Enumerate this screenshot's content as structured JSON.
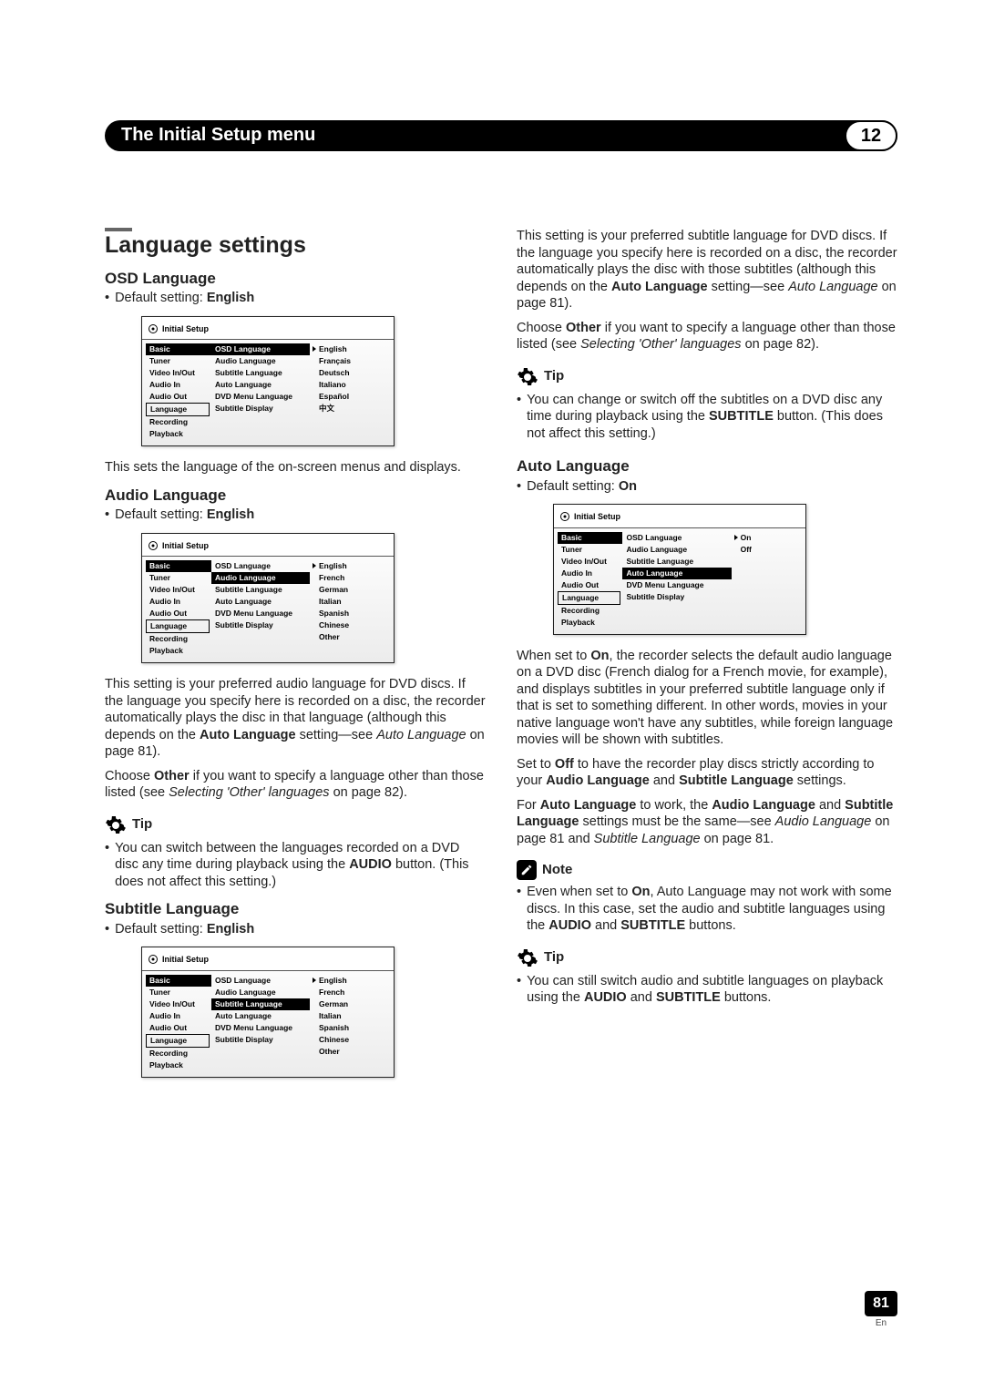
{
  "header": {
    "chapter_title": "The Initial Setup menu",
    "chapter_number": "12"
  },
  "left": {
    "section_title": "Language settings",
    "osd": {
      "heading": "OSD Language",
      "default_line": "Default setting: ",
      "default_value": "English",
      "panel_title": "Initial Setup",
      "sidebar": [
        "Basic",
        "Tuner",
        "Video In/Out",
        "Audio In",
        "Audio Out",
        "Language",
        "Recording",
        "Playback"
      ],
      "middle": [
        "OSD Language",
        "Audio Language",
        "Subtitle Language",
        "Auto Language",
        "DVD Menu Language",
        "Subtitle Display"
      ],
      "options": [
        "English",
        "Français",
        "Deutsch",
        "Italiano",
        "Español",
        "中文"
      ],
      "text": "This sets the language of the on-screen menus and displays."
    },
    "audio": {
      "heading": "Audio Language",
      "default_line": "Default setting: ",
      "default_value": "English",
      "panel_title": "Initial Setup",
      "sidebar": [
        "Basic",
        "Tuner",
        "Video In/Out",
        "Audio In",
        "Audio Out",
        "Language",
        "Recording",
        "Playback"
      ],
      "middle": [
        "OSD Language",
        "Audio Language",
        "Subtitle Language",
        "Auto Language",
        "DVD Menu Language",
        "Subtitle Display"
      ],
      "options": [
        "English",
        "French",
        "German",
        "Italian",
        "Spanish",
        "Chinese",
        "Other"
      ],
      "p1a": "This setting is your preferred audio language for DVD discs. If the language you specify here is recorded on a disc, the recorder automatically plays the disc in that language (although this depends on the ",
      "p1b": "Auto Language",
      "p1c": " setting—see ",
      "p1d": "Auto Language",
      "p1e": " on page 81).",
      "p2a": "Choose ",
      "p2b": "Other",
      "p2c": " if you want to specify a language other than those listed (see ",
      "p2d": "Selecting 'Other' languages",
      "p2e": " on page 82).",
      "tip_label": "Tip",
      "tip_a": "You can switch between the languages recorded on a DVD disc any time during playback using the ",
      "tip_b": "AUDIO",
      "tip_c": " button. (This does not affect this setting.)"
    },
    "subtitle": {
      "heading": "Subtitle Language",
      "default_line": "Default setting: ",
      "default_value": "English",
      "panel_title": "Initial Setup",
      "sidebar": [
        "Basic",
        "Tuner",
        "Video In/Out",
        "Audio In",
        "Audio Out",
        "Language",
        "Recording",
        "Playback"
      ],
      "middle": [
        "OSD Language",
        "Audio Language",
        "Subtitle Language",
        "Auto Language",
        "DVD Menu Language",
        "Subtitle Display"
      ],
      "options": [
        "English",
        "French",
        "German",
        "Italian",
        "Spanish",
        "Chinese",
        "Other"
      ]
    }
  },
  "right": {
    "p1a": "This setting is your preferred subtitle language for DVD discs. If the language you specify here is recorded on a disc, the recorder automatically plays the disc with those subtitles (although this depends on the ",
    "p1b": "Auto Language",
    "p1c": " setting—see ",
    "p1d": "Auto Language",
    "p1e": " on page 81).",
    "p2a": "Choose ",
    "p2b": "Other",
    "p2c": " if you want to specify a language other than those listed (see ",
    "p2d": "Selecting 'Other' languages",
    "p2e": " on page 82).",
    "tip1_label": "Tip",
    "tip1_a": "You can change or switch off the subtitles on a DVD disc any time during playback using the ",
    "tip1_b": "SUBTITLE",
    "tip1_c": " button. (This does not affect this setting.)",
    "auto": {
      "heading": "Auto Language",
      "default_line": "Default setting: ",
      "default_value": "On",
      "panel_title": "Initial Setup",
      "sidebar": [
        "Basic",
        "Tuner",
        "Video In/Out",
        "Audio In",
        "Audio Out",
        "Language",
        "Recording",
        "Playback"
      ],
      "middle": [
        "OSD Language",
        "Audio Language",
        "Subtitle Language",
        "Auto Language",
        "DVD Menu Language",
        "Subtitle Display"
      ],
      "options": [
        "On",
        "Off"
      ]
    },
    "p3a": "When set to ",
    "p3b": "On",
    "p3c": ", the recorder selects the default audio language on a DVD disc (French dialog for a French movie, for example), and displays subtitles in your preferred subtitle language only if that is set to something different. In other words, movies in your native language won't have any subtitles, while foreign language movies will be shown with subtitles.",
    "p4a": "Set to ",
    "p4b": "Off",
    "p4c": " to have the recorder play discs strictly according to your ",
    "p4d": "Audio Language",
    "p4e": " and ",
    "p4f": "Subtitle Language",
    "p4g": " settings.",
    "p5a": "For ",
    "p5b": "Auto Language",
    "p5c": " to work, the ",
    "p5d": "Audio Language",
    "p5e": " and ",
    "p5f": "Subtitle Language",
    "p5g": " settings must be the same—see ",
    "p5h": "Audio Language",
    "p5i": " on page 81 and ",
    "p5j": "Subtitle Language",
    "p5k": " on page 81.",
    "note_label": "Note",
    "note_a": "Even when set to ",
    "note_b": "On",
    "note_c": ", Auto Language may not work with some discs. In this case, set the audio and subtitle languages using the ",
    "note_d": "AUDIO",
    "note_e": " and ",
    "note_f": "SUBTITLE",
    "note_g": " buttons.",
    "tip2_label": "Tip",
    "tip2_a": "You can still switch audio and subtitle languages on playback using the ",
    "tip2_b": "AUDIO",
    "tip2_c": " and ",
    "tip2_d": "SUBTITLE",
    "tip2_e": " buttons."
  },
  "footer": {
    "page": "81",
    "lang": "En"
  }
}
